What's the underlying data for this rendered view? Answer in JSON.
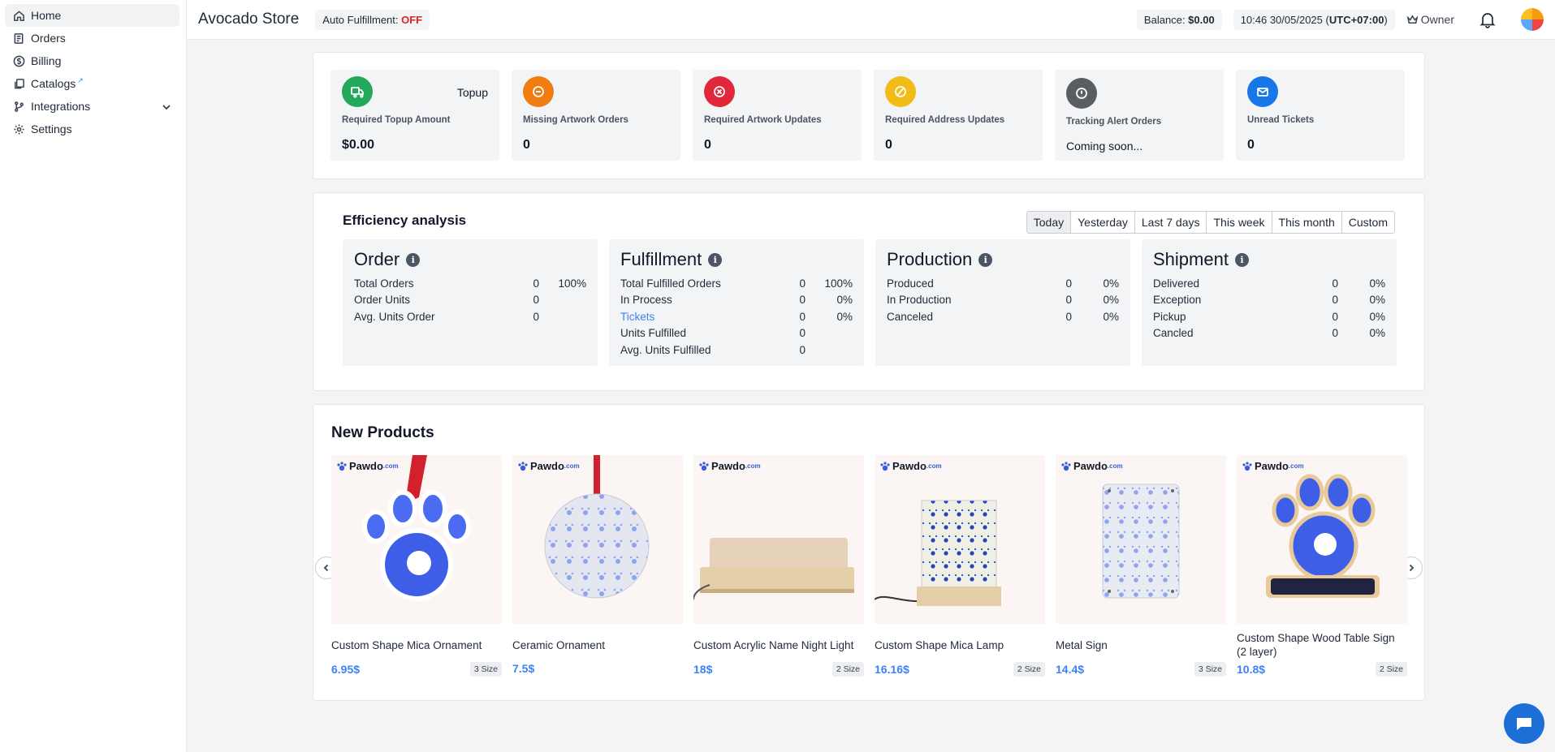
{
  "sidebar": {
    "items": [
      {
        "label": "Home",
        "icon": "home-icon"
      },
      {
        "label": "Orders",
        "icon": "orders-icon"
      },
      {
        "label": "Billing",
        "icon": "dollar-icon"
      },
      {
        "label": "Catalogs",
        "icon": "catalog-icon"
      },
      {
        "label": "Integrations",
        "icon": "branch-icon"
      },
      {
        "label": "Settings",
        "icon": "gear-icon"
      }
    ]
  },
  "header": {
    "store_name": "Avocado Store",
    "auto_label": "Auto Fulfillment:",
    "auto_value": "OFF",
    "balance_label": "Balance:",
    "balance_value": "$0.00",
    "time": "10:46 30/05/2025",
    "timezone": "UTC+07:00",
    "role": "Owner"
  },
  "stats": [
    {
      "label": "Required Topup Amount",
      "value": "$0.00",
      "tag": "Topup",
      "color": "#22a85a"
    },
    {
      "label": "Missing Artwork Orders",
      "value": "0",
      "color": "#f07c12"
    },
    {
      "label": "Required Artwork Updates",
      "value": "0",
      "color": "#e0283a"
    },
    {
      "label": "Required Address Updates",
      "value": "0",
      "color": "#f2bc18"
    },
    {
      "label": "Tracking Alert Orders",
      "value": "Coming soon...",
      "color": "#5a5e63"
    },
    {
      "label": "Unread Tickets",
      "value": "0",
      "color": "#1877e8"
    }
  ],
  "efficiency": {
    "title": "Efficiency analysis",
    "ranges": [
      "Today",
      "Yesterday",
      "Last 7 days",
      "This week",
      "This month",
      "Custom"
    ],
    "boxes": [
      {
        "title": "Order",
        "rows": [
          {
            "name": "Total Orders",
            "count": "0",
            "pct": "100%"
          },
          {
            "name": "Order Units",
            "count": "0",
            "pct": ""
          },
          {
            "name": "Avg. Units Order",
            "count": "0",
            "pct": ""
          }
        ]
      },
      {
        "title": "Fulfillment",
        "rows": [
          {
            "name": "Total Fulfilled Orders",
            "count": "0",
            "pct": "100%"
          },
          {
            "name": "In Process",
            "count": "0",
            "pct": "0%"
          },
          {
            "name": "Tickets",
            "count": "0",
            "pct": "0%"
          },
          {
            "name": "Units Fulfilled",
            "count": "0",
            "pct": ""
          },
          {
            "name": "Avg. Units Fulfilled",
            "count": "0",
            "pct": ""
          }
        ]
      },
      {
        "title": "Production",
        "rows": [
          {
            "name": "Produced",
            "count": "0",
            "pct": "0%"
          },
          {
            "name": "In Production",
            "count": "0",
            "pct": "0%"
          },
          {
            "name": "Canceled",
            "count": "0",
            "pct": "0%"
          }
        ]
      },
      {
        "title": "Shipment",
        "rows": [
          {
            "name": "Delivered",
            "count": "0",
            "pct": "0%"
          },
          {
            "name": "Exception",
            "count": "0",
            "pct": "0%"
          },
          {
            "name": "Pickup",
            "count": "0",
            "pct": "0%"
          },
          {
            "name": "Cancled",
            "count": "0",
            "pct": "0%"
          }
        ]
      }
    ]
  },
  "products": {
    "title": "New Products",
    "brand": "Pawdo",
    "brand_suffix": ".com",
    "items": [
      {
        "name": "Custom Shape Mica Ornament",
        "price": "6.95$",
        "size": "3 Size"
      },
      {
        "name": "Ceramic Ornament",
        "price": "7.5$",
        "size": ""
      },
      {
        "name": "Custom Acrylic Name Night Light",
        "price": "18$",
        "size": "2 Size"
      },
      {
        "name": "Custom Shape Mica Lamp",
        "price": "16.16$",
        "size": "2 Size"
      },
      {
        "name": "Metal Sign",
        "price": "14.4$",
        "size": "3 Size"
      },
      {
        "name": "Custom Shape Wood Table Sign (2 layer)",
        "price": "10.8$",
        "size": "2 Size"
      }
    ]
  }
}
